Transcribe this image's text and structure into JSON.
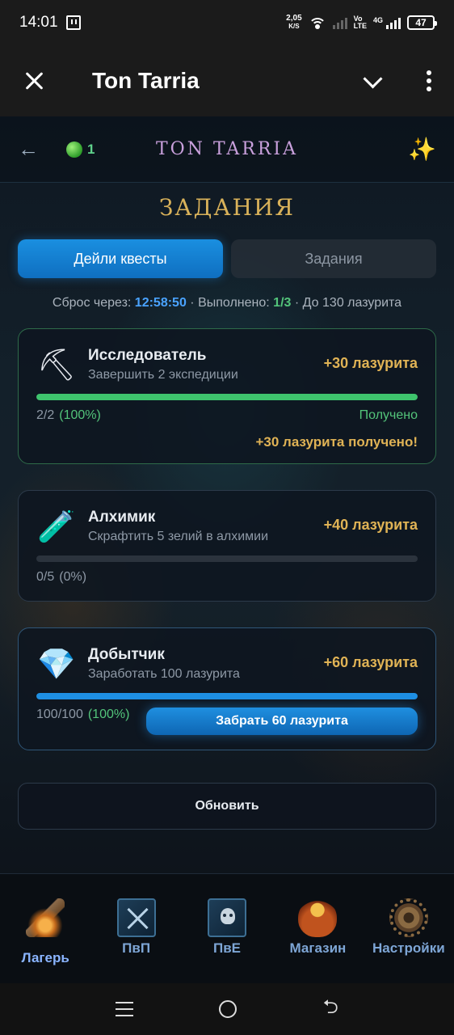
{
  "status_bar": {
    "time": "14:01",
    "net_speed_value": "2,05",
    "net_speed_unit": "K/S",
    "network_type_top": "Vo",
    "network_type_bottom": "LTE",
    "signal_label": "4G",
    "battery": "47"
  },
  "app_bar": {
    "title": "Ton Tarria"
  },
  "game_header": {
    "back_icon": "arrow-left-icon",
    "gem_count": "1",
    "title": "TON TARRIA",
    "sparkle_icon": "sparkles-icon"
  },
  "section_title": "ЗАДАНИЯ",
  "tabs": [
    {
      "label": "Дейли квесты",
      "active": true
    },
    {
      "label": "Задания",
      "active": false
    }
  ],
  "info": {
    "reset_label": "Сброс через:",
    "reset_time": "12:58:50",
    "separator": "·",
    "done_label": "Выполнено:",
    "done_value": "1/3",
    "limit_text": "До 130 лазурита"
  },
  "quests": [
    {
      "icon": "pickaxe-icon",
      "icon_glyph": "⛏",
      "name": "Исследователь",
      "description": "Завершить 2 экспедиции",
      "reward": "+30 лазурита",
      "progress_text": "2/2",
      "percent_text": "(100%)",
      "progress_fraction": 1.0,
      "status": "Получено",
      "received_text": "+30 лазурита получено!"
    },
    {
      "icon": "potion-icon",
      "icon_glyph": "🧪",
      "name": "Алхимик",
      "description": "Скрафтить 5 зелий в алхимии",
      "reward": "+40 лазурита",
      "progress_text": "0/5",
      "percent_text": "(0%)",
      "progress_fraction": 0.0
    },
    {
      "icon": "diamond-icon",
      "icon_glyph": "💎",
      "name": "Добытчик",
      "description": "Заработать 100 лазурита",
      "reward": "+60 лазурита",
      "progress_text": "100/100",
      "percent_text": "(100%)",
      "progress_fraction": 1.0,
      "claim_button": "Забрать 60 лазурита"
    }
  ],
  "refresh_button": "Обновить",
  "bottom_nav": [
    {
      "label": "Лагерь",
      "icon": "campfire-icon",
      "active": true
    },
    {
      "label": "ПвП",
      "icon": "pvp-swords-icon",
      "active": false
    },
    {
      "label": "ПвЕ",
      "icon": "pve-skull-icon",
      "active": false
    },
    {
      "label": "Магазин",
      "icon": "gold-bag-icon",
      "active": false
    },
    {
      "label": "Настройки",
      "icon": "gear-icon",
      "active": false
    }
  ],
  "colors": {
    "accent_blue": "#1a8fe0",
    "reward_gold": "#e0b355",
    "success_green": "#53c47a",
    "title_purple": "#c9a0dc"
  }
}
